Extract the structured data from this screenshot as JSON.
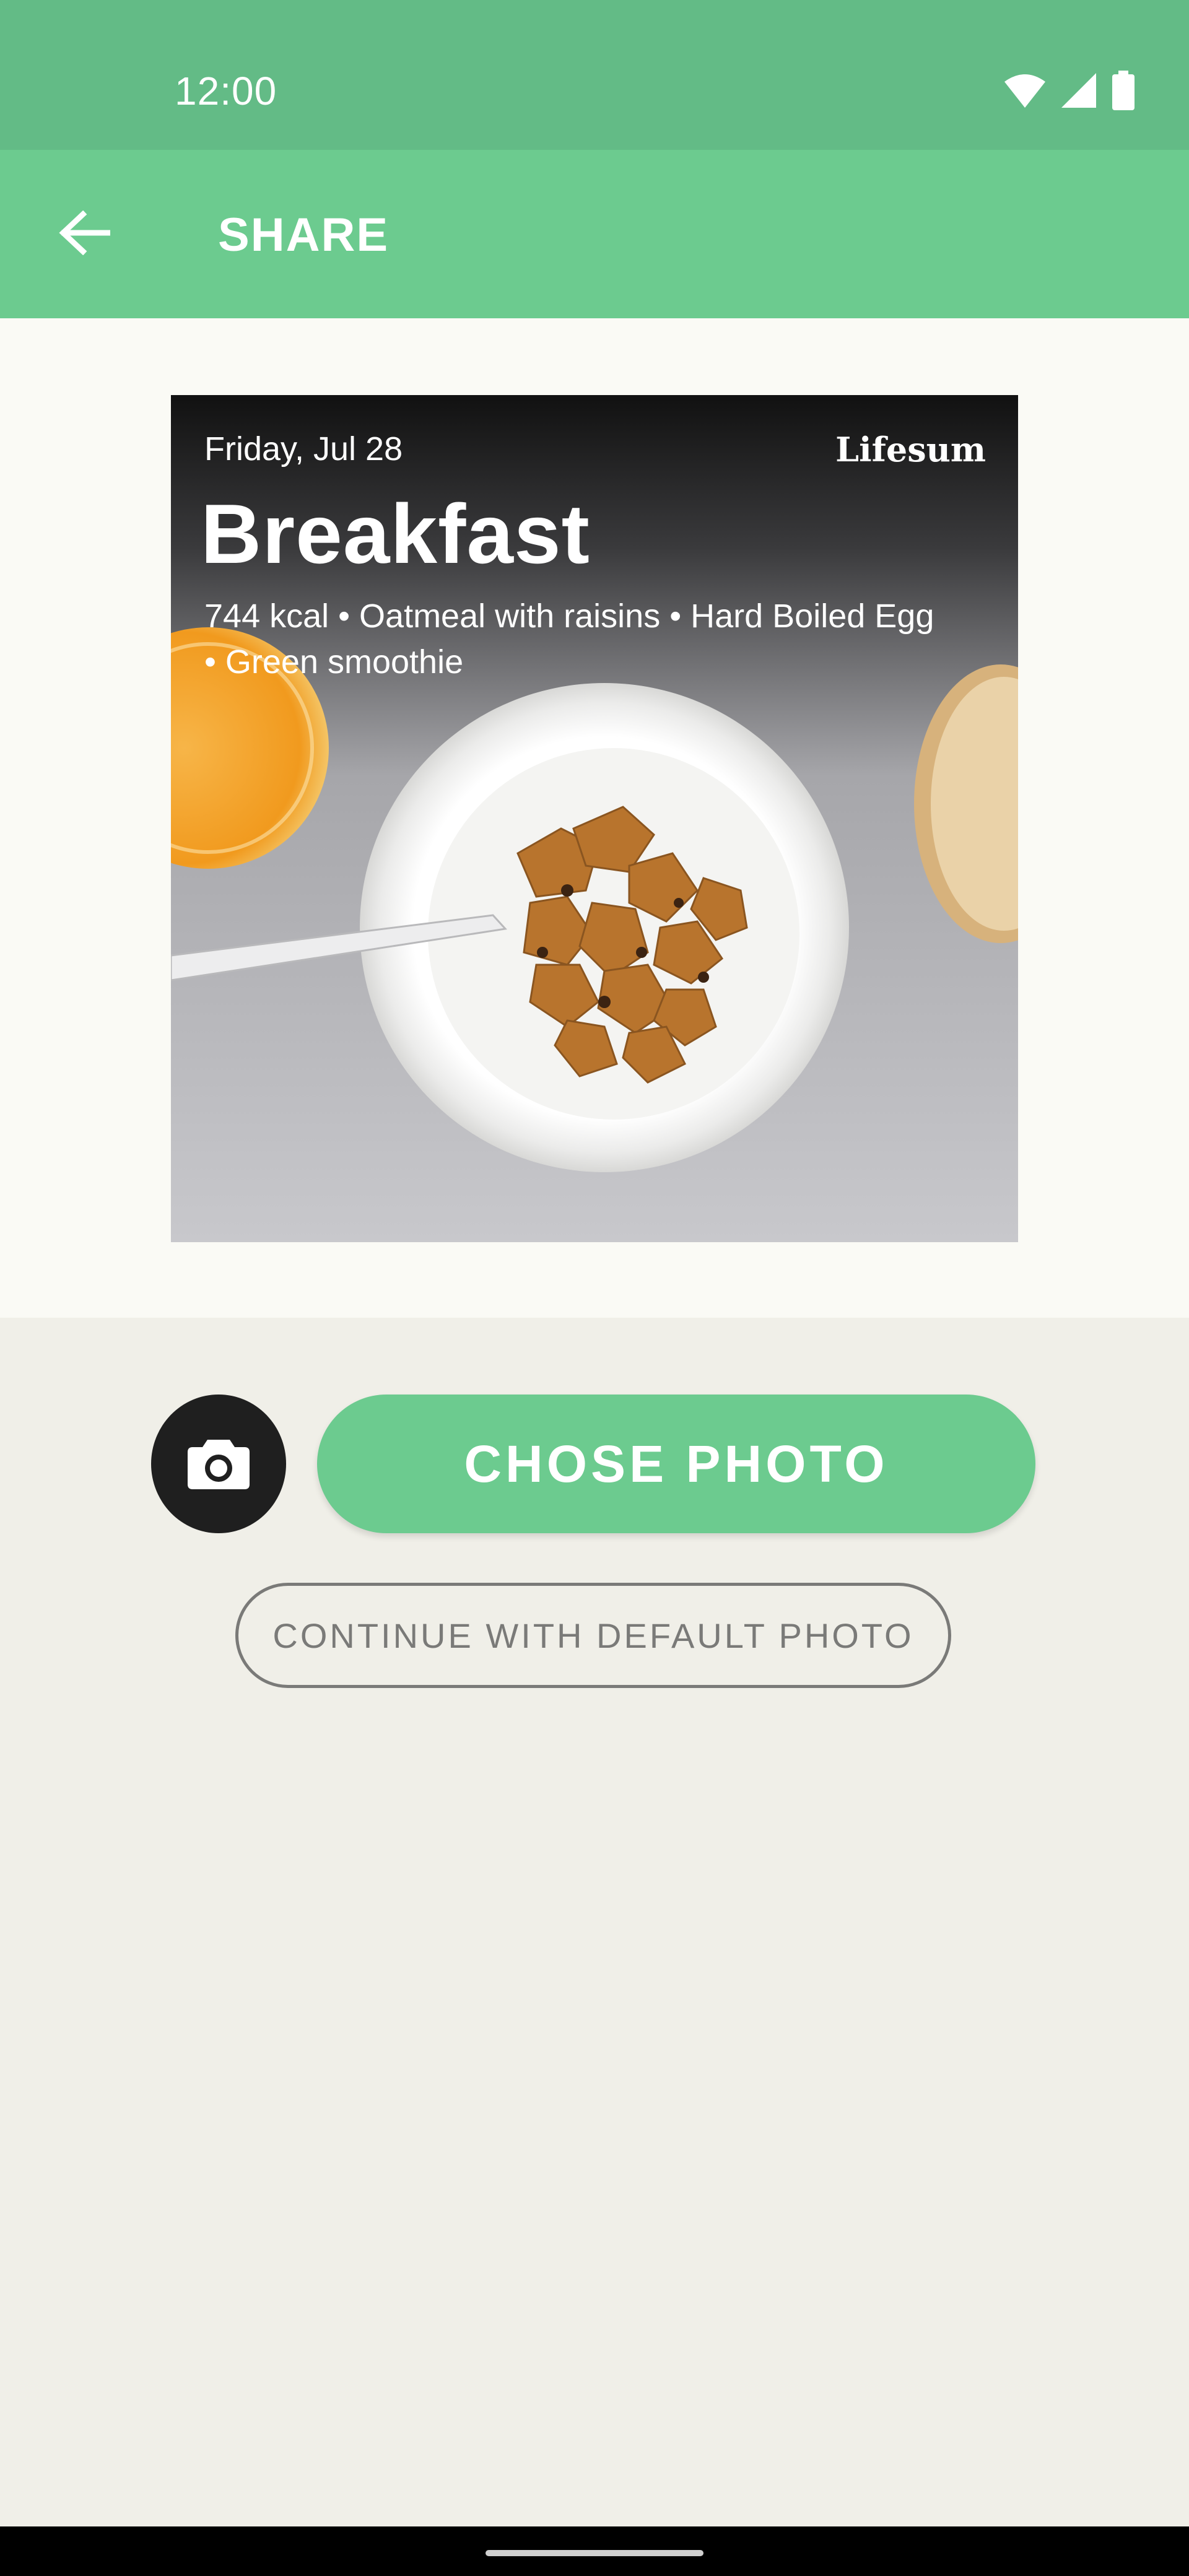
{
  "status_bar": {
    "time": "12:00",
    "icons": [
      "wifi-icon",
      "signal-icon",
      "battery-icon"
    ]
  },
  "app_bar": {
    "back_icon": "arrow-back-icon",
    "title": "SHARE"
  },
  "share_card": {
    "date": "Friday, Jul 28",
    "brand": "Lifesum",
    "meal_title": "Breakfast",
    "summary": "744 kcal • Oatmeal with raisins • Hard Boiled Egg • Green smoothie"
  },
  "actions": {
    "camera_icon": "camera-icon",
    "choose_photo_label": "CHOSE PHOTO",
    "default_photo_label": "CONTINUE WITH DEFAULT PHOTO"
  },
  "colors": {
    "status_bar": "#63bb86",
    "accent": "#6ccb8f",
    "background": "#f0efe8",
    "dark_button": "#1f1f1f"
  }
}
